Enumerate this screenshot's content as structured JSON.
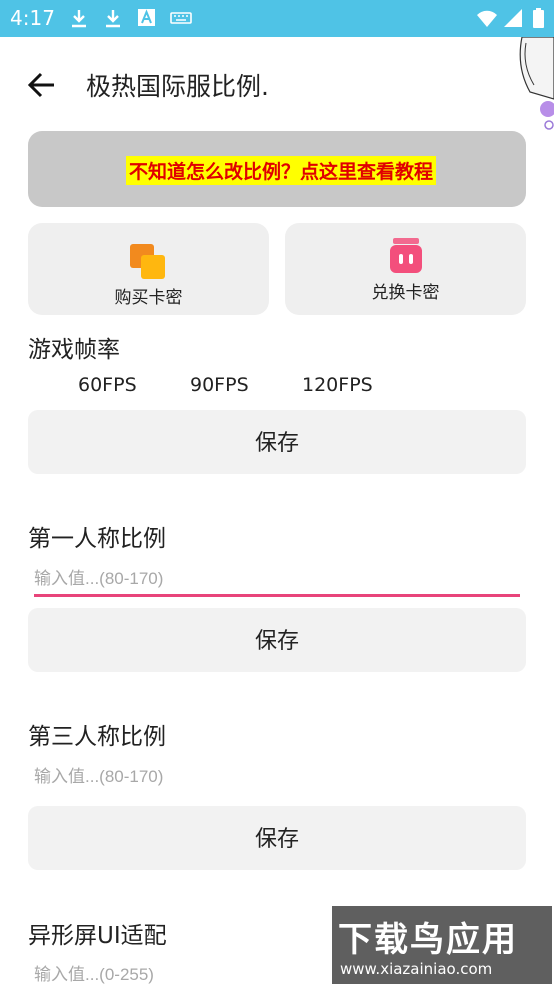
{
  "status_bar": {
    "time": "4:17",
    "icons": [
      "download-icon",
      "download-icon",
      "font-icon",
      "keyboard-icon",
      "wifi-icon",
      "signal-icon",
      "battery-icon"
    ]
  },
  "header": {
    "title": "极热国际服比例."
  },
  "banner": {
    "text": "不知道怎么改比例？点这里查看教程"
  },
  "cards": {
    "buy": {
      "label": "购买卡密"
    },
    "redeem": {
      "label": "兑换卡密"
    }
  },
  "fps_section": {
    "title": "游戏帧率",
    "options": [
      "60FPS",
      "90FPS",
      "120FPS"
    ],
    "save_label": "保存"
  },
  "first_person": {
    "title": "第一人称比例",
    "placeholder": "输入值...(80-170)",
    "save_label": "保存"
  },
  "third_person": {
    "title": "第三人称比例",
    "placeholder": "输入值...(80-170)",
    "save_label": "保存"
  },
  "notch": {
    "title": "异形屏UI适配",
    "placeholder": "输入值...(0-255)"
  },
  "watermark": {
    "main": "下载鸟应用",
    "sub": "www.xiazainiao.com"
  },
  "colors": {
    "status_bar": "#4fc3e6",
    "accent": "#e8447a",
    "banner_highlight": "#ffff00",
    "banner_text": "#e00000"
  }
}
